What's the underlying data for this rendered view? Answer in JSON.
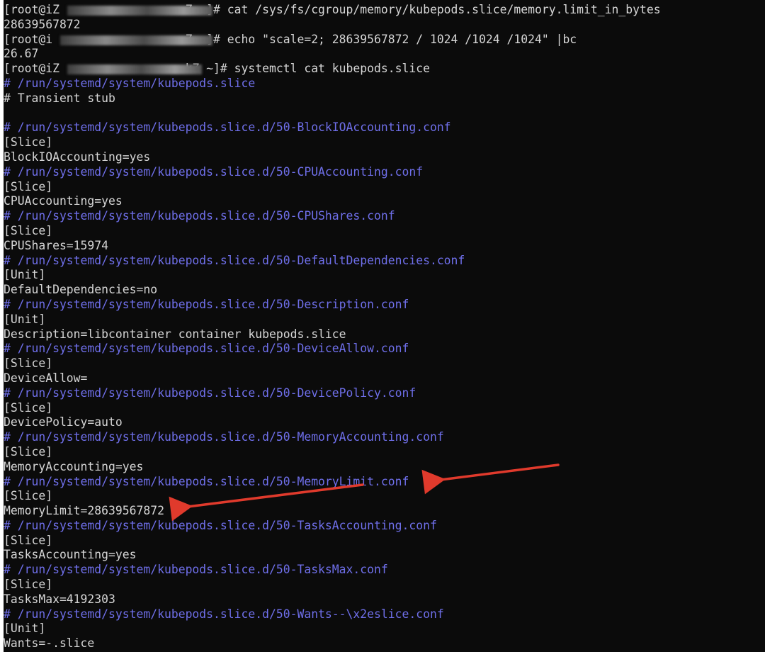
{
  "terminal": {
    "lines": [
      {
        "text": "[root@iZ                  Z ~]# cat /sys/fs/cgroup/memory/kubepods.slice/memory.limit_in_bytes",
        "kind": "plain"
      },
      {
        "text": "28639567872",
        "kind": "plain"
      },
      {
        "text": "[root@i                   Z ~]# echo \"scale=2; 28639567872 / 1024 /1024 /1024\" |bc",
        "kind": "plain"
      },
      {
        "text": "26.67",
        "kind": "plain"
      },
      {
        "text": "[root@iZ                  kZ ~]# systemctl cat kubepods.slice",
        "kind": "plain"
      },
      {
        "text": "# /run/systemd/system/kubepods.slice",
        "kind": "comment"
      },
      {
        "text": "# Transient stub",
        "kind": "plain"
      },
      {
        "text": " ",
        "kind": "blank"
      },
      {
        "text": "# /run/systemd/system/kubepods.slice.d/50-BlockIOAccounting.conf",
        "kind": "comment"
      },
      {
        "text": "[Slice]",
        "kind": "plain"
      },
      {
        "text": "BlockIOAccounting=yes",
        "kind": "plain"
      },
      {
        "text": "# /run/systemd/system/kubepods.slice.d/50-CPUAccounting.conf",
        "kind": "comment"
      },
      {
        "text": "[Slice]",
        "kind": "plain"
      },
      {
        "text": "CPUAccounting=yes",
        "kind": "plain"
      },
      {
        "text": "# /run/systemd/system/kubepods.slice.d/50-CPUShares.conf",
        "kind": "comment"
      },
      {
        "text": "[Slice]",
        "kind": "plain"
      },
      {
        "text": "CPUShares=15974",
        "kind": "plain"
      },
      {
        "text": "# /run/systemd/system/kubepods.slice.d/50-DefaultDependencies.conf",
        "kind": "comment"
      },
      {
        "text": "[Unit]",
        "kind": "plain"
      },
      {
        "text": "DefaultDependencies=no",
        "kind": "plain"
      },
      {
        "text": "# /run/systemd/system/kubepods.slice.d/50-Description.conf",
        "kind": "comment"
      },
      {
        "text": "[Unit]",
        "kind": "plain"
      },
      {
        "text": "Description=libcontainer container kubepods.slice",
        "kind": "plain"
      },
      {
        "text": "# /run/systemd/system/kubepods.slice.d/50-DeviceAllow.conf",
        "kind": "comment"
      },
      {
        "text": "[Slice]",
        "kind": "plain"
      },
      {
        "text": "DeviceAllow=",
        "kind": "plain"
      },
      {
        "text": "# /run/systemd/system/kubepods.slice.d/50-DevicePolicy.conf",
        "kind": "comment"
      },
      {
        "text": "[Slice]",
        "kind": "plain"
      },
      {
        "text": "DevicePolicy=auto",
        "kind": "plain"
      },
      {
        "text": "# /run/systemd/system/kubepods.slice.d/50-MemoryAccounting.conf",
        "kind": "comment"
      },
      {
        "text": "[Slice]",
        "kind": "plain"
      },
      {
        "text": "MemoryAccounting=yes",
        "kind": "plain"
      },
      {
        "text": "# /run/systemd/system/kubepods.slice.d/50-MemoryLimit.conf",
        "kind": "comment"
      },
      {
        "text": "[Slice]",
        "kind": "plain"
      },
      {
        "text": "MemoryLimit=28639567872",
        "kind": "plain"
      },
      {
        "text": "# /run/systemd/system/kubepods.slice.d/50-TasksAccounting.conf",
        "kind": "comment"
      },
      {
        "text": "[Slice]",
        "kind": "plain"
      },
      {
        "text": "TasksAccounting=yes",
        "kind": "plain"
      },
      {
        "text": "# /run/systemd/system/kubepods.slice.d/50-TasksMax.conf",
        "kind": "comment"
      },
      {
        "text": "[Slice]",
        "kind": "plain"
      },
      {
        "text": "TasksMax=4192303",
        "kind": "plain"
      },
      {
        "text": "# /run/systemd/system/kubepods.slice.d/50-Wants--\\x2eslice.conf",
        "kind": "comment"
      },
      {
        "text": "[Unit]",
        "kind": "plain"
      },
      {
        "text": "Wants=-.slice",
        "kind": "plain"
      }
    ]
  },
  "colors": {
    "background": "#0b0b0b",
    "text": "#d6d6d6",
    "comment": "#6f6fea",
    "annotation_arrow": "#e03a2c"
  },
  "annotations": [
    {
      "kind": "arrow",
      "icon": "red-arrow-icon",
      "points_to": "# /run/systemd/system/kubepods.slice.d/50-MemoryLimit.conf"
    },
    {
      "kind": "arrow",
      "icon": "red-arrow-icon",
      "points_to": "MemoryLimit=28639567872"
    }
  ]
}
